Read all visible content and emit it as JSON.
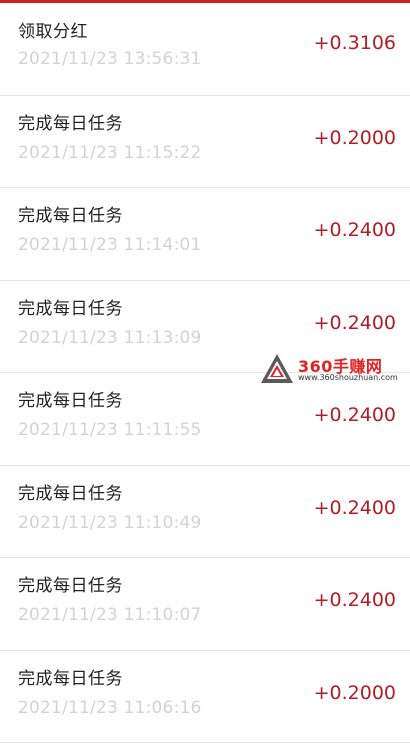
{
  "records": [
    {
      "title": "领取分红",
      "time": "2021/11/23 13:56:31",
      "amount": "+0.3106"
    },
    {
      "title": "完成每日任务",
      "time": "2021/11/23 11:15:22",
      "amount": "+0.2000"
    },
    {
      "title": "完成每日任务",
      "time": "2021/11/23 11:14:01",
      "amount": "+0.2400"
    },
    {
      "title": "完成每日任务",
      "time": "2021/11/23 11:13:09",
      "amount": "+0.2400"
    },
    {
      "title": "完成每日任务",
      "time": "2021/11/23 11:11:55",
      "amount": "+0.2400"
    },
    {
      "title": "完成每日任务",
      "time": "2021/11/23 11:10:49",
      "amount": "+0.2400"
    },
    {
      "title": "完成每日任务",
      "time": "2021/11/23 11:10:07",
      "amount": "+0.2400"
    },
    {
      "title": "完成每日任务",
      "time": "2021/11/23 11:06:16",
      "amount": "+0.2000"
    }
  ],
  "watermark": {
    "name": "360手赚网",
    "url": "www.360shouzhuan.com"
  },
  "colors": {
    "accent": "#d11f2a",
    "amount": "#b01e26",
    "time": "#d3d3d3"
  }
}
